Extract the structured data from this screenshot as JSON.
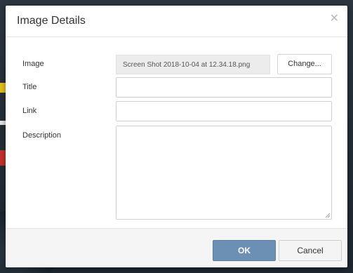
{
  "dialog": {
    "title": "Image Details",
    "close_icon": "close-icon"
  },
  "form": {
    "image_label": "Image",
    "image_filename": "Screen Shot 2018-10-04 at 12.34.18.png",
    "change_label": "Change...",
    "title_label": "Title",
    "title_value": "",
    "link_label": "Link",
    "link_value": "",
    "description_label": "Description",
    "description_value": ""
  },
  "footer": {
    "ok_label": "OK",
    "cancel_label": "Cancel"
  },
  "colors": {
    "primary_button": "#6b90b3",
    "backdrop": "#1f2a33"
  }
}
